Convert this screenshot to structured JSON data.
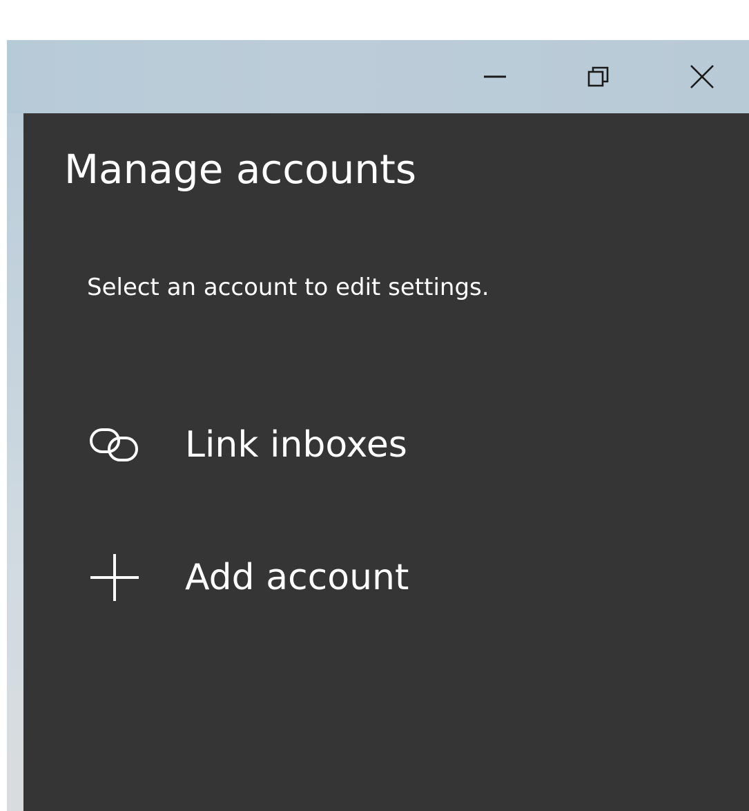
{
  "window": {
    "controls": {
      "minimize": "minimize-icon",
      "restore": "restore-icon",
      "close": "close-icon"
    }
  },
  "page": {
    "title": "Manage accounts",
    "subtitle": "Select an account to edit settings."
  },
  "actions": [
    {
      "label": "Link inboxes",
      "icon": "link-icon"
    },
    {
      "label": "Add account",
      "icon": "plus-icon"
    }
  ],
  "colors": {
    "panel_background": "#353535",
    "titlebar_background": "#b9cbd8",
    "text": "#ffffff",
    "caption_glyph": "#1a1a1a"
  }
}
